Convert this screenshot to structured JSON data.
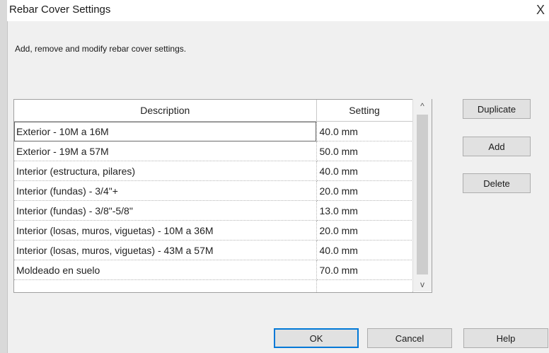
{
  "window": {
    "title": "Rebar Cover Settings",
    "close_glyph": "X"
  },
  "instructions": "Add, remove and modify rebar cover settings.",
  "table": {
    "headers": {
      "description": "Description",
      "setting": "Setting"
    },
    "rows": [
      {
        "description": "Exterior - 10M a 16M",
        "setting": "40.0 mm"
      },
      {
        "description": "Exterior - 19M a 57M",
        "setting": "50.0 mm"
      },
      {
        "description": "Interior (estructura, pilares)",
        "setting": "40.0 mm"
      },
      {
        "description": "Interior (fundas) - 3/4\"+",
        "setting": "20.0 mm"
      },
      {
        "description": "Interior (fundas) - 3/8\"-5/8\"",
        "setting": "13.0 mm"
      },
      {
        "description": "Interior (losas, muros, viguetas) - 10M a 36M",
        "setting": "20.0 mm"
      },
      {
        "description": "Interior (losas, muros, viguetas) - 43M a 57M",
        "setting": "40.0 mm"
      },
      {
        "description": "Moldeado en suelo",
        "setting": "70.0 mm"
      }
    ],
    "selected_row": 0,
    "scroll_up_glyph": "^",
    "scroll_down_glyph": "v"
  },
  "side_buttons": {
    "duplicate": "Duplicate",
    "add": "Add",
    "delete": "Delete"
  },
  "footer_buttons": {
    "ok": "OK",
    "cancel": "Cancel",
    "help": "Help"
  },
  "icons": {
    "close": "close-icon",
    "scroll_up": "chevron-up-icon",
    "scroll_down": "chevron-down-icon"
  }
}
